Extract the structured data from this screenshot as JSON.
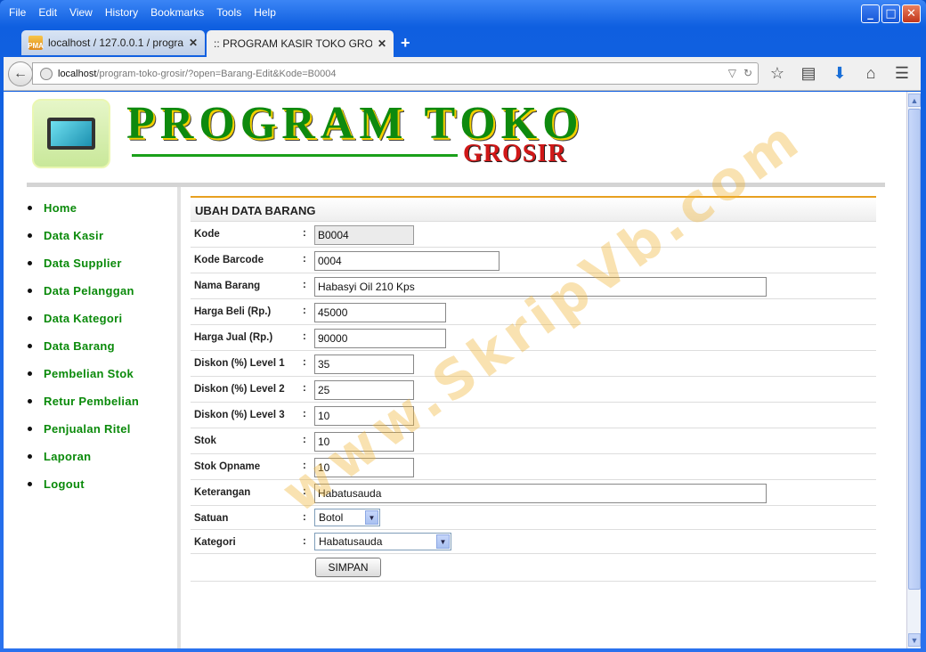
{
  "browser": {
    "menu": [
      "File",
      "Edit",
      "View",
      "History",
      "Bookmarks",
      "Tools",
      "Help"
    ],
    "tabs": [
      {
        "title": "localhost / 127.0.0.1 / progra...",
        "icon_text": "PMA"
      },
      {
        "title": ":: PROGRAM KASIR TOKO GROSI..."
      }
    ],
    "url_host": "localhost",
    "url_rest": "/program-toko-grosir/?open=Barang-Edit&Kode=B0004"
  },
  "header": {
    "title_main": "PROGRAM TOKO",
    "title_sub": "GROSIR"
  },
  "sidebar": {
    "items": [
      "Home",
      "Data Kasir",
      "Data Supplier",
      "Data Pelanggan",
      "Data Kategori",
      "Data Barang",
      "Pembelian Stok",
      "Retur Pembelian",
      "Penjualan Ritel",
      "Laporan",
      "Logout"
    ]
  },
  "form": {
    "heading": "UBAH DATA BARANG",
    "colon": ":",
    "fields": [
      {
        "label": "Kode",
        "value": "B0004"
      },
      {
        "label": "Kode Barcode",
        "value": "0004"
      },
      {
        "label": "Nama Barang",
        "value": "Habasyi Oil 210 Kps"
      },
      {
        "label": "Harga Beli (Rp.)",
        "value": "45000"
      },
      {
        "label": "Harga Jual (Rp.)",
        "value": "90000"
      },
      {
        "label": "Diskon (%) Level 1",
        "value": "35"
      },
      {
        "label": "Diskon (%) Level 2",
        "value": "25"
      },
      {
        "label": "Diskon (%) Level 3",
        "value": "10"
      },
      {
        "label": "Stok",
        "value": "10"
      },
      {
        "label": "Stok Opname",
        "value": "10"
      },
      {
        "label": "Keterangan",
        "value": "Habatusauda"
      },
      {
        "label": "Satuan",
        "value": "Botol"
      },
      {
        "label": "Kategori",
        "value": "Habatusauda"
      }
    ],
    "submit": "SIMPAN"
  },
  "watermark": "www.SkripVb.com"
}
